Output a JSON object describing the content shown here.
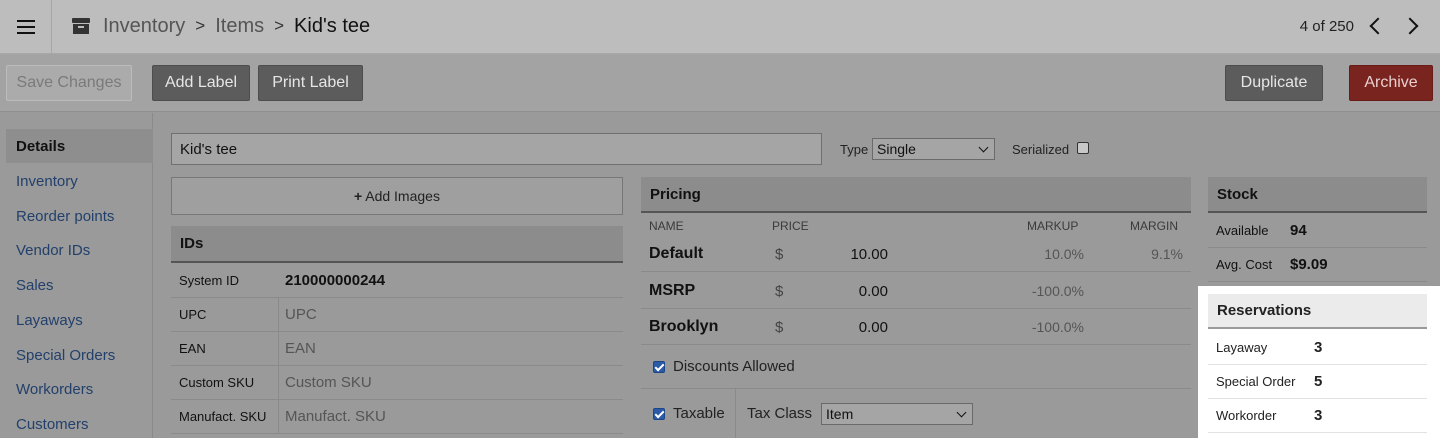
{
  "header": {
    "breadcrumb": [
      "Inventory",
      "Items"
    ],
    "current": "Kid's tee",
    "pager": "4 of 250",
    "icons": [
      "menu-icon",
      "box-icon",
      "chevron-left-icon",
      "chevron-right-icon"
    ]
  },
  "toolbar": {
    "save": "Save Changes",
    "add_label": "Add Label",
    "print_label": "Print Label",
    "duplicate": "Duplicate",
    "archive": "Archive"
  },
  "sidebar": {
    "items": [
      "Details",
      "Inventory",
      "Reorder points",
      "Vendor IDs",
      "Sales",
      "Layaways",
      "Special Orders",
      "Workorders",
      "Customers"
    ]
  },
  "form": {
    "name": "Kid's tee",
    "type_label": "Type",
    "type_value": "Single",
    "serialized_label": "Serialized",
    "add_images": "Add Images"
  },
  "ids": {
    "title": "IDs",
    "rows": [
      {
        "label": "System ID",
        "value": "210000000244"
      },
      {
        "label": "UPC",
        "value": "UPC"
      },
      {
        "label": "EAN",
        "value": "EAN"
      },
      {
        "label": "Custom SKU",
        "value": "Custom SKU"
      },
      {
        "label": "Manufact. SKU",
        "value": "Manufact. SKU"
      }
    ]
  },
  "pricing": {
    "title": "Pricing",
    "columns": [
      "NAME",
      "PRICE",
      "MARKUP",
      "MARGIN"
    ],
    "rows": [
      {
        "name": "Default",
        "currency": "$",
        "price": "10.00",
        "markup": "10.0%",
        "margin": "9.1%"
      },
      {
        "name": "MSRP",
        "currency": "$",
        "price": "0.00",
        "markup": "-100.0%",
        "margin": ""
      },
      {
        "name": "Brooklyn",
        "currency": "$",
        "price": "0.00",
        "markup": "-100.0%",
        "margin": ""
      }
    ],
    "discounts_label": "Discounts Allowed",
    "taxable_label": "Taxable",
    "tax_class_label": "Tax Class",
    "tax_class_value": "Item"
  },
  "stock": {
    "title": "Stock",
    "rows": [
      {
        "label": "Available",
        "value": "94"
      },
      {
        "label": "Avg. Cost",
        "value": "$9.09"
      }
    ]
  },
  "reservations": {
    "title": "Reservations",
    "rows": [
      {
        "label": "Layaway",
        "value": "3"
      },
      {
        "label": "Special Order",
        "value": "5"
      },
      {
        "label": "Workorder",
        "value": "3"
      }
    ]
  }
}
